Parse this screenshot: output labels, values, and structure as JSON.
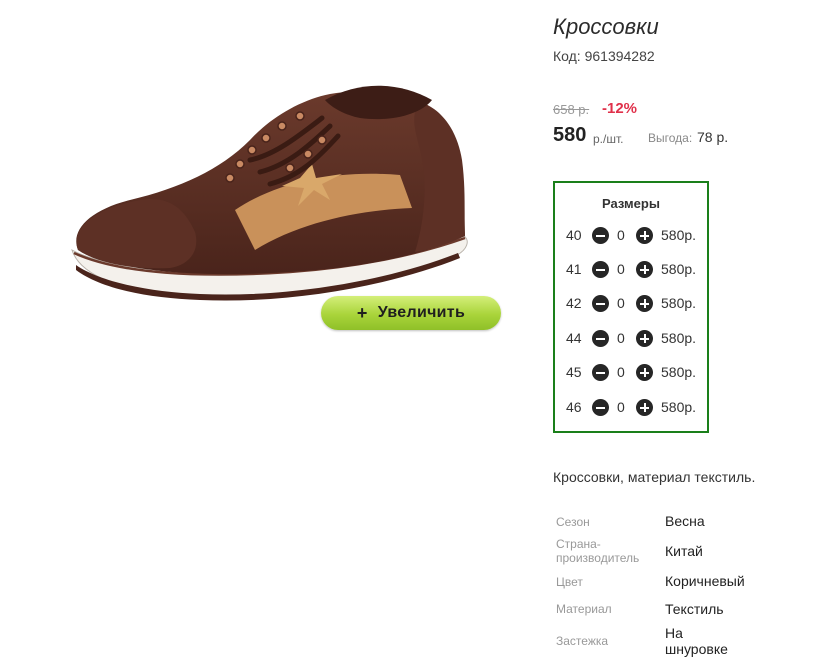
{
  "product": {
    "title": "Кроссовки",
    "sku_label": "Код: 961394282",
    "old_price": "658 р.",
    "discount": "-12%",
    "price": "580",
    "price_unit": "р./шт.",
    "savings_label": "Выгода:",
    "savings_value": "78 р.",
    "zoom_button": "Увеличить",
    "zoom_icon": "+",
    "description": "Кроссовки, материал текстиль."
  },
  "sizes": {
    "title": "Размеры",
    "rows": [
      {
        "size": "40",
        "qty": "0",
        "price": "580р."
      },
      {
        "size": "41",
        "qty": "0",
        "price": "580р."
      },
      {
        "size": "42",
        "qty": "0",
        "price": "580р."
      },
      {
        "size": "44",
        "qty": "0",
        "price": "580р."
      },
      {
        "size": "45",
        "qty": "0",
        "price": "580р."
      },
      {
        "size": "46",
        "qty": "0",
        "price": "580р."
      }
    ]
  },
  "attributes": [
    {
      "label": "Сезон",
      "value": "Весна"
    },
    {
      "label": "Страна-производитель",
      "value": "Китай"
    },
    {
      "label": "Цвет",
      "value": "Коричневый"
    },
    {
      "label": "Материал",
      "value": "Текстиль"
    },
    {
      "label": "Застежка",
      "value": "На шнуровке"
    }
  ],
  "colors": {
    "sizes_border": "#1a7f1a",
    "discount": "#e0304a",
    "zoom_button": "#a9d43a",
    "shoe_body": "#5a2e22",
    "shoe_accent": "#c9915a"
  },
  "icons": {
    "minus": "minus-circle-icon",
    "plus": "plus-circle-icon"
  }
}
